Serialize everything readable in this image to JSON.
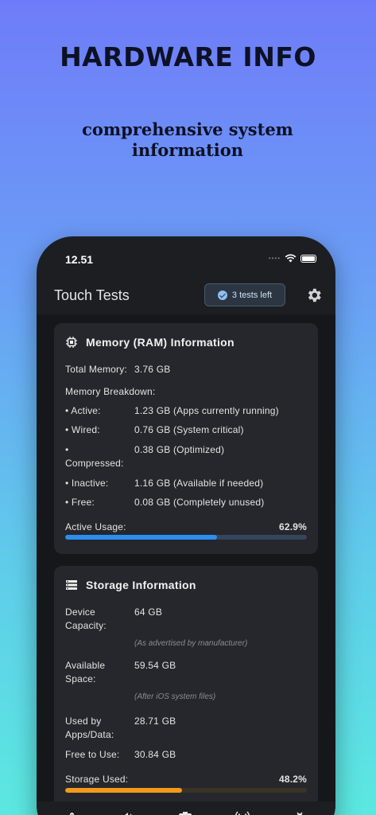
{
  "hero": {
    "title": "HARDWARE INFO",
    "subtitle": "comprehensive system information"
  },
  "status_bar": {
    "time": "12.51"
  },
  "navbar": {
    "title": "Touch Tests",
    "tests_badge": "3 tests left"
  },
  "memory_card": {
    "title": "Memory (RAM) Information",
    "total_label": "Total Memory:",
    "total_value": "3.76 GB",
    "breakdown_label": "Memory Breakdown:",
    "rows": [
      {
        "label": "• Active:",
        "value": "1.23 GB (Apps currently running)"
      },
      {
        "label": "• Wired:",
        "value": "0.76 GB (System critical)"
      },
      {
        "label": "•",
        "label2": "Compressed:",
        "value": "0.38 GB (Optimized)"
      },
      {
        "label": "• Inactive:",
        "value": "1.16 GB (Available if needed)"
      },
      {
        "label": "• Free:",
        "value": "0.08 GB (Completely unused)"
      }
    ],
    "usage_label": "Active Usage:",
    "usage_value": "62.9%",
    "usage_fraction": 0.629,
    "usage_color": "#2b8ef0"
  },
  "storage_card": {
    "title": "Storage Information",
    "capacity_label_1": "Device",
    "capacity_label_2": "Capacity:",
    "capacity_value": "64 GB",
    "capacity_note": "(As advertised by manufacturer)",
    "available_label_1": "Available",
    "available_label_2": "Space:",
    "available_value": "59.54 GB",
    "available_note": "(After iOS system files)",
    "used_label_1": "Used by",
    "used_label_2": "Apps/Data:",
    "used_value": "28.71 GB",
    "free_label": "Free to Use:",
    "free_value": "30.84 GB",
    "storage_used_label": "Storage Used:",
    "storage_used_value": "48.2%",
    "storage_fraction": 0.482,
    "storage_color": "#f39a1b"
  },
  "tab_bar": {
    "icons": [
      "touch-icon",
      "speaker-icon",
      "camera-icon",
      "broadcast-icon",
      "bug-icon"
    ]
  }
}
